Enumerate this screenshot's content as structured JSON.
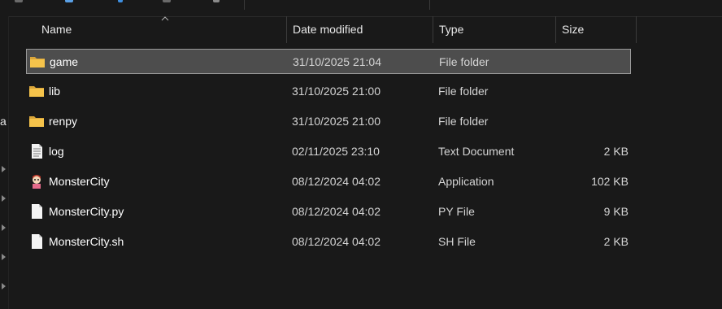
{
  "columns": {
    "name": "Name",
    "date": "Date modified",
    "type": "Type",
    "size": "Size"
  },
  "left_pane": {
    "letter": "a"
  },
  "files": [
    {
      "name": "game",
      "date": "31/10/2025 21:04",
      "type": "File folder",
      "size": "",
      "icon": "folder-icon",
      "selected": true
    },
    {
      "name": "lib",
      "date": "31/10/2025 21:00",
      "type": "File folder",
      "size": "",
      "icon": "folder-icon",
      "selected": false
    },
    {
      "name": "renpy",
      "date": "31/10/2025 21:00",
      "type": "File folder",
      "size": "",
      "icon": "folder-icon",
      "selected": false
    },
    {
      "name": "log",
      "date": "02/11/2025 23:10",
      "type": "Text Document",
      "size": "2 KB",
      "icon": "text-document-icon",
      "selected": false
    },
    {
      "name": "MonsterCity",
      "date": "08/12/2024 04:02",
      "type": "Application",
      "size": "102 KB",
      "icon": "application-icon",
      "selected": false
    },
    {
      "name": "MonsterCity.py",
      "date": "08/12/2024 04:02",
      "type": "PY File",
      "size": "9 KB",
      "icon": "file-icon",
      "selected": false
    },
    {
      "name": "MonsterCity.sh",
      "date": "08/12/2024 04:02",
      "type": "SH File",
      "size": "2 KB",
      "icon": "file-icon",
      "selected": false
    }
  ],
  "colors": {
    "background": "#191919",
    "selection": "#4d4d4d",
    "folder": "#f5c34b"
  }
}
